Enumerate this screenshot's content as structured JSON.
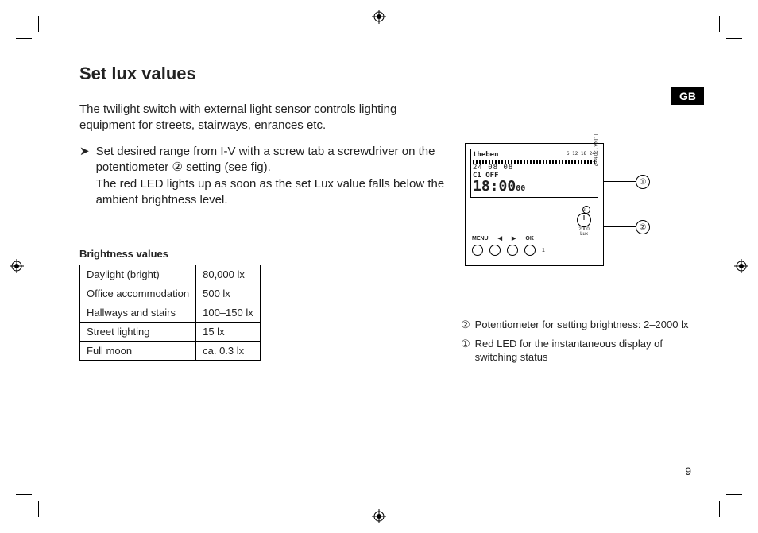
{
  "lang_tab": "GB",
  "title": "Set lux values",
  "intro": "The twilight switch with external light sensor controls lighting equipment for streets, stairways, enrances etc.",
  "bullet_arrow": "➤",
  "bullet_text_1": "Set desired range from I-V with a screw tab a screw­driver on the potentiometer ② setting (see fig).",
  "bullet_text_2": "The red LED lights up as soon as the set Lux value falls below the ambient brightness level.",
  "table_title": "Brightness values",
  "brightness_rows": [
    {
      "name": "Daylight (bright)",
      "value": "80,000 lx"
    },
    {
      "name": "Office accommodation",
      "value": "500 lx"
    },
    {
      "name": " Hallways and stairs",
      "value": "100–150 lx"
    },
    {
      "name": "Street lighting",
      "value": "15 lx"
    },
    {
      "name": " Full moon",
      "value": "ca. 0.3 lx"
    }
  ],
  "device": {
    "brand": "theben",
    "ticks": "6   12   18   24",
    "date": "24  08  08",
    "c1": "C1 OFF",
    "time_main": "18:00",
    "time_sec": "00",
    "menu": "MENU",
    "ok": "OK",
    "left": "◀",
    "right": "▶",
    "led_side": "LUNA 120 top2",
    "pot_lo": "2",
    "pot_hi": "2000",
    "pot_unit": "Lux",
    "btn_num": "1"
  },
  "callout_1": "①",
  "callout_2": "②",
  "legend": [
    {
      "num": "②",
      "text": "Potentiometer for setting brightness: 2–2000 lx"
    },
    {
      "num": "①",
      "text": "Red LED for the instantaneous display of switching status"
    }
  ],
  "page_number": "9"
}
